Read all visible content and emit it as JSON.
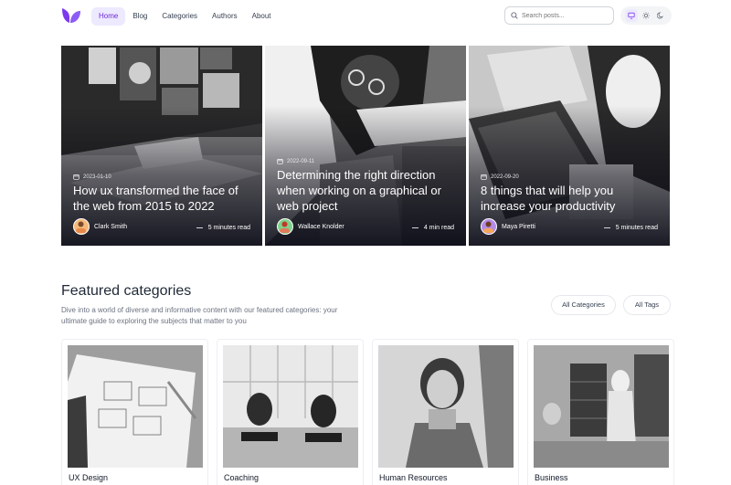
{
  "header": {
    "logo_icon": "leaf-logo-icon",
    "nav": [
      "Home",
      "Blog",
      "Categories",
      "Authors",
      "About"
    ],
    "active_nav": "Home",
    "search_placeholder": "Search posts...",
    "theme_modes": [
      "monitor-icon",
      "sun-icon",
      "moon-icon"
    ],
    "accent": "#6d28d9"
  },
  "hero": [
    {
      "date": "2023-01-10",
      "title": "How ux transformed the face of the web from 2015 to 2022",
      "author": "Clark Smith",
      "read": "5 minutes read"
    },
    {
      "date": "2022-09-11",
      "title": "Determining the right direction when working on a graphical or web project",
      "author": "Wallace Knolder",
      "read": "4 min read"
    },
    {
      "date": "2022-09-20",
      "title": "8 things that will help you increase your productivity",
      "author": "Maya Piretti",
      "read": "5 minutes read"
    }
  ],
  "featured": {
    "title": "Featured categories",
    "description": "Dive into a world of diverse and informative content with our featured categories: your ultimate guide to exploring the subjects that matter to you",
    "all_categories": "All Categories",
    "all_tags": "All Tags",
    "categories": [
      "UX Design",
      "Coaching",
      "Human Resources",
      "Business"
    ]
  }
}
